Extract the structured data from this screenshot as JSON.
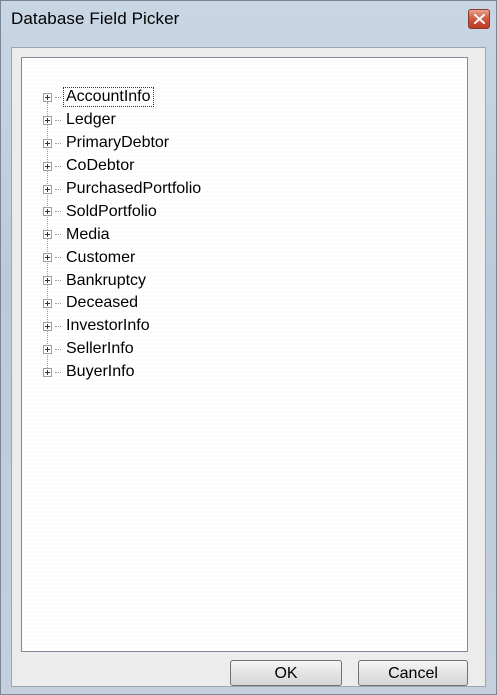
{
  "window": {
    "title": "Database Field Picker"
  },
  "tree": {
    "items": [
      {
        "label": "AccountInfo",
        "focused": true
      },
      {
        "label": "Ledger"
      },
      {
        "label": "PrimaryDebtor"
      },
      {
        "label": "CoDebtor"
      },
      {
        "label": "PurchasedPortfolio"
      },
      {
        "label": "SoldPortfolio"
      },
      {
        "label": "Media"
      },
      {
        "label": "Customer"
      },
      {
        "label": "Bankruptcy"
      },
      {
        "label": "Deceased"
      },
      {
        "label": "InvestorInfo"
      },
      {
        "label": "SellerInfo"
      },
      {
        "label": "BuyerInfo"
      }
    ]
  },
  "buttons": {
    "ok_label": "OK",
    "cancel_label": "Cancel"
  },
  "icons": {
    "close": "close-icon",
    "expand": "plus-expander-icon"
  }
}
